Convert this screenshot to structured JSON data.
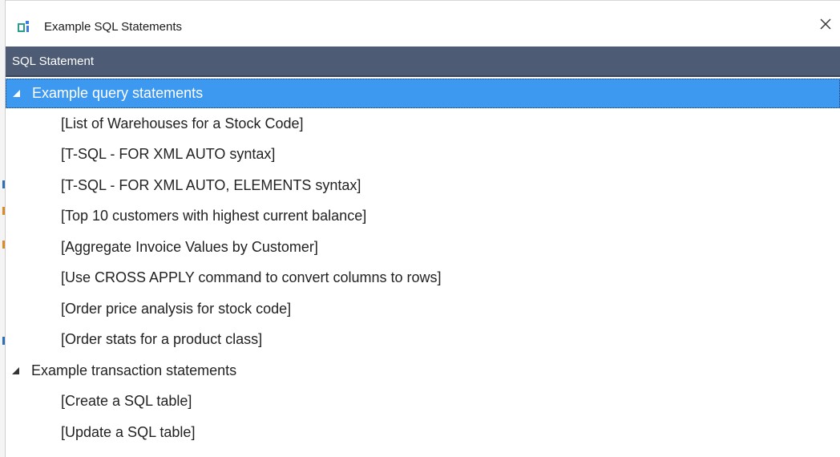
{
  "window": {
    "title": "Example SQL Statements",
    "icon": "app-icon",
    "close_icon": "close-icon",
    "accent_color": "#3d98f0",
    "header_color": "#4e5b74"
  },
  "grid": {
    "column_header": "SQL Statement"
  },
  "tree": {
    "groups": [
      {
        "label": "Example query statements",
        "expanded": true,
        "selected": true,
        "items": [
          "[List of Warehouses for a Stock Code]",
          "[T-SQL - FOR XML AUTO syntax]",
          "[T-SQL - FOR XML AUTO, ELEMENTS syntax]",
          "[Top 10 customers with highest current balance]",
          "[Aggregate Invoice Values by Customer]",
          "[Use CROSS APPLY command to convert columns to rows]",
          "[Order price analysis for stock code]",
          "[Order stats for a product class]"
        ]
      },
      {
        "label": "Example transaction statements",
        "expanded": true,
        "selected": false,
        "items": [
          "[Create a SQL table]",
          "[Update a SQL table]"
        ]
      }
    ]
  }
}
